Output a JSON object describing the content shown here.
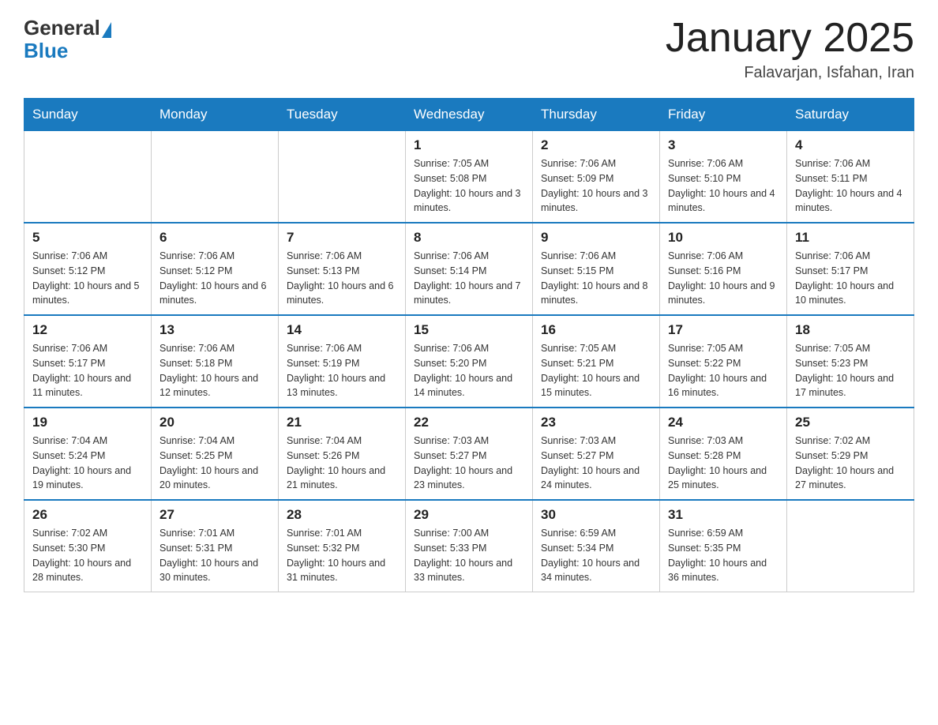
{
  "header": {
    "logo_general": "General",
    "logo_blue": "Blue",
    "month_title": "January 2025",
    "location": "Falavarjan, Isfahan, Iran"
  },
  "days_of_week": [
    "Sunday",
    "Monday",
    "Tuesday",
    "Wednesday",
    "Thursday",
    "Friday",
    "Saturday"
  ],
  "weeks": [
    [
      {
        "day": "",
        "sunrise": "",
        "sunset": "",
        "daylight": ""
      },
      {
        "day": "",
        "sunrise": "",
        "sunset": "",
        "daylight": ""
      },
      {
        "day": "",
        "sunrise": "",
        "sunset": "",
        "daylight": ""
      },
      {
        "day": "1",
        "sunrise": "Sunrise: 7:05 AM",
        "sunset": "Sunset: 5:08 PM",
        "daylight": "Daylight: 10 hours and 3 minutes."
      },
      {
        "day": "2",
        "sunrise": "Sunrise: 7:06 AM",
        "sunset": "Sunset: 5:09 PM",
        "daylight": "Daylight: 10 hours and 3 minutes."
      },
      {
        "day": "3",
        "sunrise": "Sunrise: 7:06 AM",
        "sunset": "Sunset: 5:10 PM",
        "daylight": "Daylight: 10 hours and 4 minutes."
      },
      {
        "day": "4",
        "sunrise": "Sunrise: 7:06 AM",
        "sunset": "Sunset: 5:11 PM",
        "daylight": "Daylight: 10 hours and 4 minutes."
      }
    ],
    [
      {
        "day": "5",
        "sunrise": "Sunrise: 7:06 AM",
        "sunset": "Sunset: 5:12 PM",
        "daylight": "Daylight: 10 hours and 5 minutes."
      },
      {
        "day": "6",
        "sunrise": "Sunrise: 7:06 AM",
        "sunset": "Sunset: 5:12 PM",
        "daylight": "Daylight: 10 hours and 6 minutes."
      },
      {
        "day": "7",
        "sunrise": "Sunrise: 7:06 AM",
        "sunset": "Sunset: 5:13 PM",
        "daylight": "Daylight: 10 hours and 6 minutes."
      },
      {
        "day": "8",
        "sunrise": "Sunrise: 7:06 AM",
        "sunset": "Sunset: 5:14 PM",
        "daylight": "Daylight: 10 hours and 7 minutes."
      },
      {
        "day": "9",
        "sunrise": "Sunrise: 7:06 AM",
        "sunset": "Sunset: 5:15 PM",
        "daylight": "Daylight: 10 hours and 8 minutes."
      },
      {
        "day": "10",
        "sunrise": "Sunrise: 7:06 AM",
        "sunset": "Sunset: 5:16 PM",
        "daylight": "Daylight: 10 hours and 9 minutes."
      },
      {
        "day": "11",
        "sunrise": "Sunrise: 7:06 AM",
        "sunset": "Sunset: 5:17 PM",
        "daylight": "Daylight: 10 hours and 10 minutes."
      }
    ],
    [
      {
        "day": "12",
        "sunrise": "Sunrise: 7:06 AM",
        "sunset": "Sunset: 5:17 PM",
        "daylight": "Daylight: 10 hours and 11 minutes."
      },
      {
        "day": "13",
        "sunrise": "Sunrise: 7:06 AM",
        "sunset": "Sunset: 5:18 PM",
        "daylight": "Daylight: 10 hours and 12 minutes."
      },
      {
        "day": "14",
        "sunrise": "Sunrise: 7:06 AM",
        "sunset": "Sunset: 5:19 PM",
        "daylight": "Daylight: 10 hours and 13 minutes."
      },
      {
        "day": "15",
        "sunrise": "Sunrise: 7:06 AM",
        "sunset": "Sunset: 5:20 PM",
        "daylight": "Daylight: 10 hours and 14 minutes."
      },
      {
        "day": "16",
        "sunrise": "Sunrise: 7:05 AM",
        "sunset": "Sunset: 5:21 PM",
        "daylight": "Daylight: 10 hours and 15 minutes."
      },
      {
        "day": "17",
        "sunrise": "Sunrise: 7:05 AM",
        "sunset": "Sunset: 5:22 PM",
        "daylight": "Daylight: 10 hours and 16 minutes."
      },
      {
        "day": "18",
        "sunrise": "Sunrise: 7:05 AM",
        "sunset": "Sunset: 5:23 PM",
        "daylight": "Daylight: 10 hours and 17 minutes."
      }
    ],
    [
      {
        "day": "19",
        "sunrise": "Sunrise: 7:04 AM",
        "sunset": "Sunset: 5:24 PM",
        "daylight": "Daylight: 10 hours and 19 minutes."
      },
      {
        "day": "20",
        "sunrise": "Sunrise: 7:04 AM",
        "sunset": "Sunset: 5:25 PM",
        "daylight": "Daylight: 10 hours and 20 minutes."
      },
      {
        "day": "21",
        "sunrise": "Sunrise: 7:04 AM",
        "sunset": "Sunset: 5:26 PM",
        "daylight": "Daylight: 10 hours and 21 minutes."
      },
      {
        "day": "22",
        "sunrise": "Sunrise: 7:03 AM",
        "sunset": "Sunset: 5:27 PM",
        "daylight": "Daylight: 10 hours and 23 minutes."
      },
      {
        "day": "23",
        "sunrise": "Sunrise: 7:03 AM",
        "sunset": "Sunset: 5:27 PM",
        "daylight": "Daylight: 10 hours and 24 minutes."
      },
      {
        "day": "24",
        "sunrise": "Sunrise: 7:03 AM",
        "sunset": "Sunset: 5:28 PM",
        "daylight": "Daylight: 10 hours and 25 minutes."
      },
      {
        "day": "25",
        "sunrise": "Sunrise: 7:02 AM",
        "sunset": "Sunset: 5:29 PM",
        "daylight": "Daylight: 10 hours and 27 minutes."
      }
    ],
    [
      {
        "day": "26",
        "sunrise": "Sunrise: 7:02 AM",
        "sunset": "Sunset: 5:30 PM",
        "daylight": "Daylight: 10 hours and 28 minutes."
      },
      {
        "day": "27",
        "sunrise": "Sunrise: 7:01 AM",
        "sunset": "Sunset: 5:31 PM",
        "daylight": "Daylight: 10 hours and 30 minutes."
      },
      {
        "day": "28",
        "sunrise": "Sunrise: 7:01 AM",
        "sunset": "Sunset: 5:32 PM",
        "daylight": "Daylight: 10 hours and 31 minutes."
      },
      {
        "day": "29",
        "sunrise": "Sunrise: 7:00 AM",
        "sunset": "Sunset: 5:33 PM",
        "daylight": "Daylight: 10 hours and 33 minutes."
      },
      {
        "day": "30",
        "sunrise": "Sunrise: 6:59 AM",
        "sunset": "Sunset: 5:34 PM",
        "daylight": "Daylight: 10 hours and 34 minutes."
      },
      {
        "day": "31",
        "sunrise": "Sunrise: 6:59 AM",
        "sunset": "Sunset: 5:35 PM",
        "daylight": "Daylight: 10 hours and 36 minutes."
      },
      {
        "day": "",
        "sunrise": "",
        "sunset": "",
        "daylight": ""
      }
    ]
  ]
}
